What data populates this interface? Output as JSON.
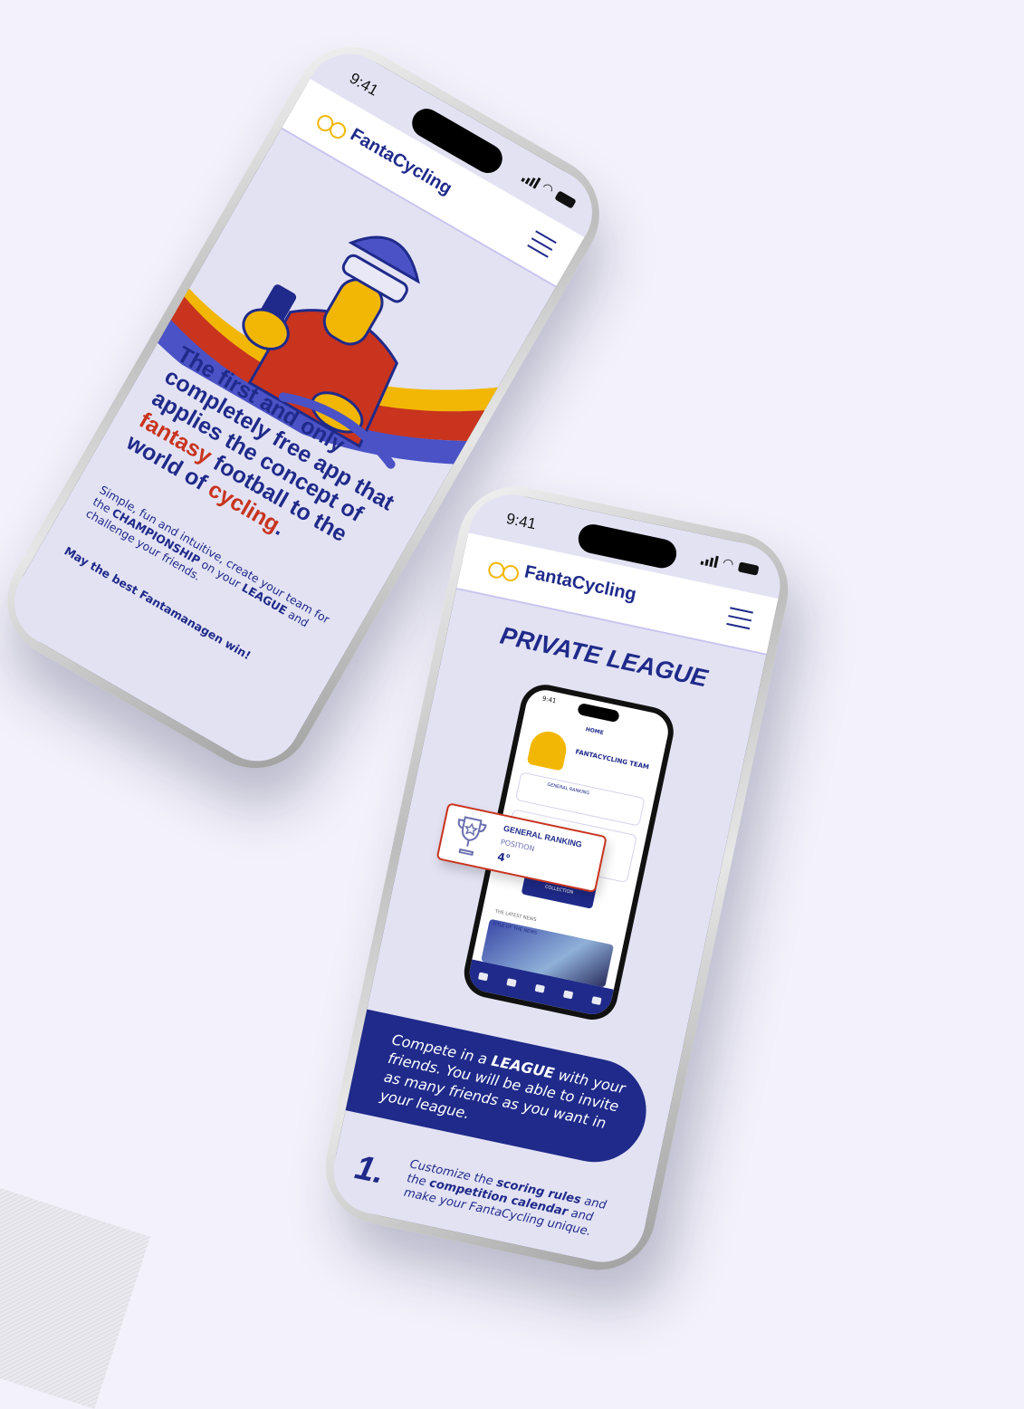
{
  "colors": {
    "navy": "#1f2a8a",
    "red": "#c8341e",
    "yellow": "#f2b705",
    "lavender": "#e3e2f3"
  },
  "status": {
    "time": "9:41"
  },
  "brand": {
    "name": "FantaCycling"
  },
  "phone1": {
    "headline_part1": "The first and only completely free app that applies the concept of ",
    "headline_red1": "fantasy",
    "headline_part2": " football to the world of ",
    "headline_red2": "cycling",
    "headline_end": ".",
    "sub_part1": "Simple, fun and intuitive, create your team for the ",
    "sub_bold1": "CHAMPIONSHIP",
    "sub_part2": " on your ",
    "sub_bold2": "LEAGUE",
    "sub_part3": " and challenge your friends.",
    "closing": "May the best Fantamanagen win!"
  },
  "phone2": {
    "title": "PRIVATE LEAGUE",
    "mini": {
      "time": "9:41",
      "home": "HOME",
      "team": "FANTACYCLING TEAM",
      "general_ranking": "GENERAL RANKING",
      "collection": "COLLECTION",
      "latest_news": "THE LATEST NEWS",
      "news_title": "TITLE OF THE NEWS"
    },
    "rank_card": {
      "title": "GENERAL RANKING",
      "label": "POSITION",
      "value": "4°"
    },
    "band_part1": "Compete in a ",
    "band_bold": "LEAGUE",
    "band_part2": " with your friends. You will be able to invite as many friends as you want in your league.",
    "step_number": "1.",
    "step_part1": "Customize the ",
    "step_bold1": "scoring rules",
    "step_part2": " and the ",
    "step_bold2": "competition calendar",
    "step_part3": " and make your FantaCycling unique."
  }
}
